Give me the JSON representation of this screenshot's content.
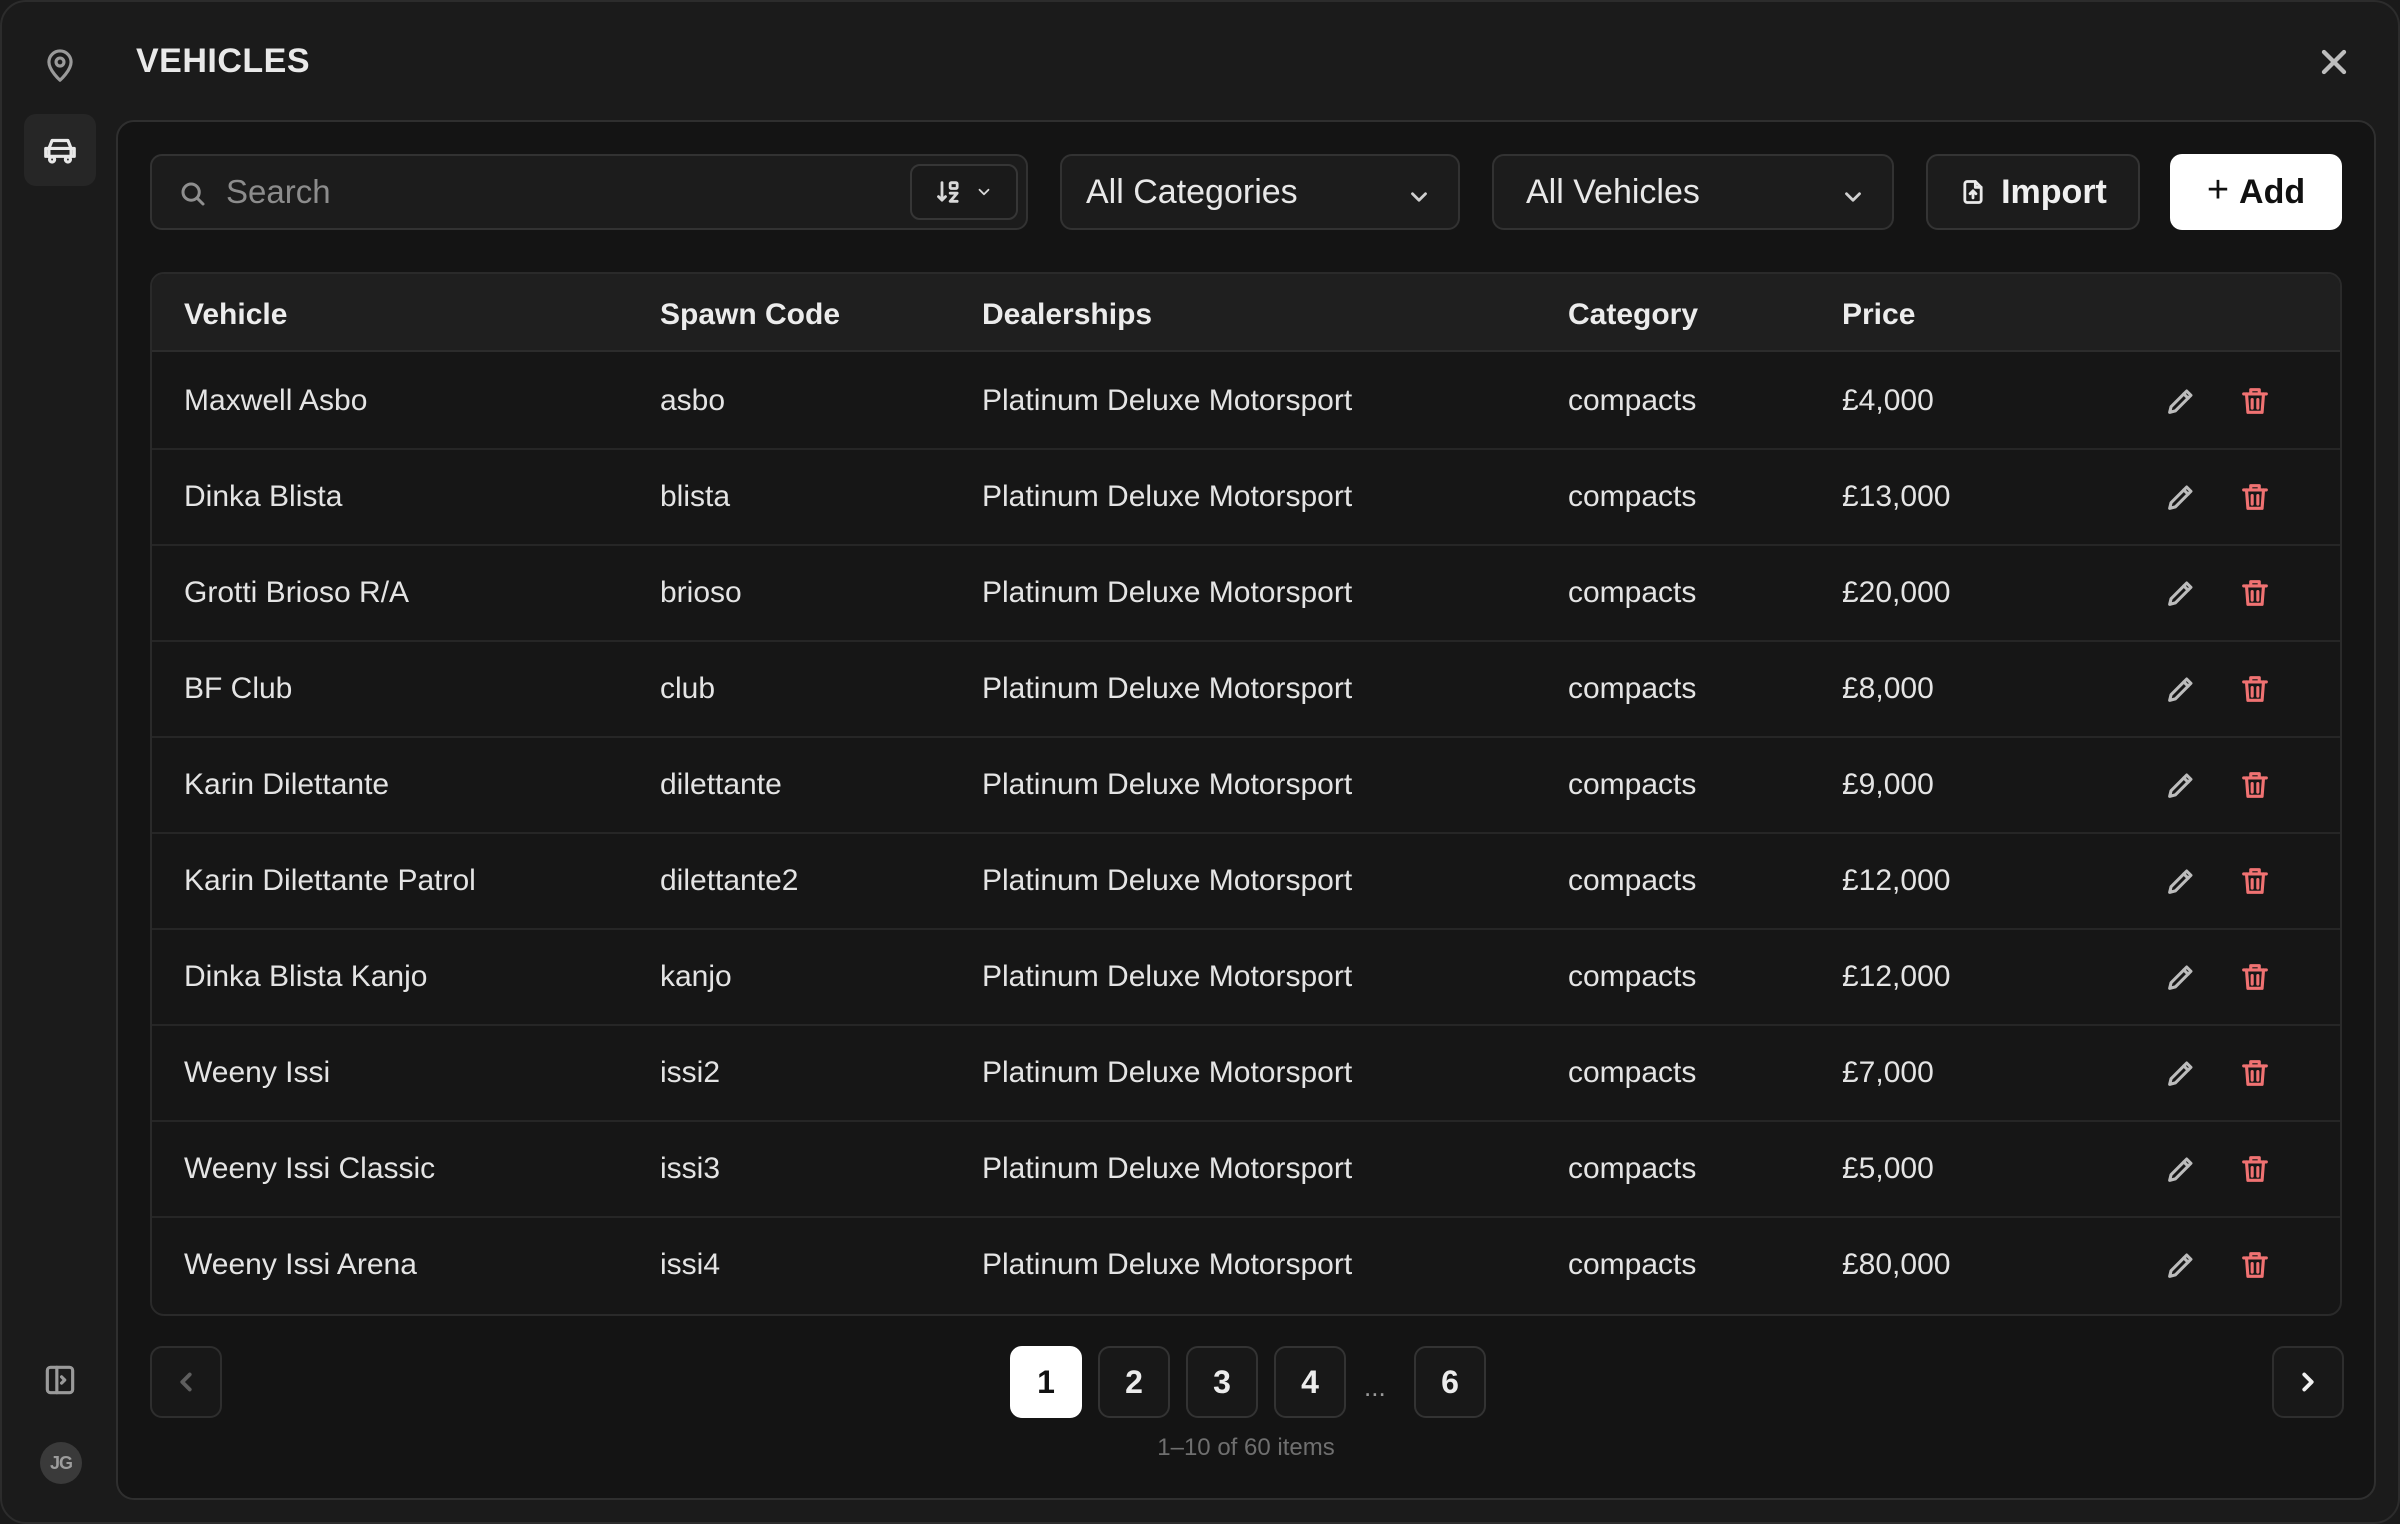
{
  "app": {
    "title": "VEHICLES"
  },
  "sidebar": {
    "avatar_initials": "JG"
  },
  "toolbar": {
    "search_placeholder": "Search",
    "category_dropdown": "All Categories",
    "vehicle_dropdown": "All Vehicles",
    "import_label": "Import",
    "add_label": "Add"
  },
  "table": {
    "headers": [
      "Vehicle",
      "Spawn Code",
      "Dealerships",
      "Category",
      "Price"
    ],
    "rows": [
      [
        "Maxwell Asbo",
        "asbo",
        "Platinum Deluxe Motorsport",
        "compacts",
        "£4,000"
      ],
      [
        "Dinka Blista",
        "blista",
        "Platinum Deluxe Motorsport",
        "compacts",
        "£13,000"
      ],
      [
        "Grotti Brioso R/A",
        "brioso",
        "Platinum Deluxe Motorsport",
        "compacts",
        "£20,000"
      ],
      [
        "BF Club",
        "club",
        "Platinum Deluxe Motorsport",
        "compacts",
        "£8,000"
      ],
      [
        "Karin Dilettante",
        "dilettante",
        "Platinum Deluxe Motorsport",
        "compacts",
        "£9,000"
      ],
      [
        "Karin Dilettante Patrol",
        "dilettante2",
        "Platinum Deluxe Motorsport",
        "compacts",
        "£12,000"
      ],
      [
        "Dinka Blista Kanjo",
        "kanjo",
        "Platinum Deluxe Motorsport",
        "compacts",
        "£12,000"
      ],
      [
        "Weeny Issi",
        "issi2",
        "Platinum Deluxe Motorsport",
        "compacts",
        "£7,000"
      ],
      [
        "Weeny Issi Classic",
        "issi3",
        "Platinum Deluxe Motorsport",
        "compacts",
        "£5,000"
      ],
      [
        "Weeny Issi Arena",
        "issi4",
        "Platinum Deluxe Motorsport",
        "compacts",
        "£80,000"
      ]
    ]
  },
  "pagination": {
    "pages": [
      "1",
      "2",
      "3",
      "4",
      "6"
    ],
    "current": "1",
    "ellipsis": "...",
    "info": "1–10 of 60 items"
  }
}
